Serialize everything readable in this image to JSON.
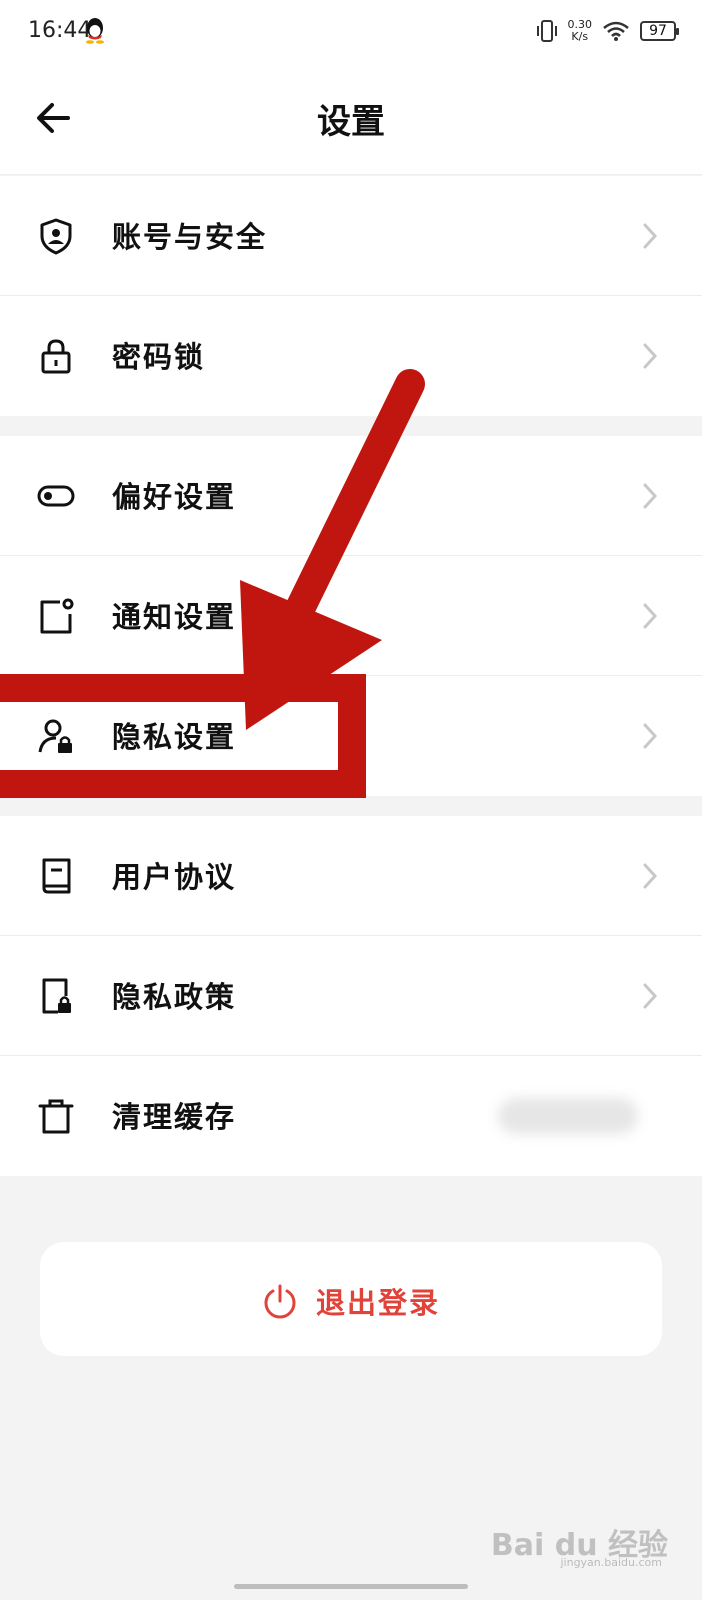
{
  "status_bar": {
    "time": "16:44",
    "net_speed_value": "0.30",
    "net_speed_unit": "K/s",
    "battery": "97"
  },
  "header": {
    "title": "设置"
  },
  "groups": [
    {
      "items": [
        {
          "label": "账号与安全",
          "icon": "shield-user-icon"
        },
        {
          "label": "密码锁",
          "icon": "lock-icon"
        }
      ]
    },
    {
      "items": [
        {
          "label": "偏好设置",
          "icon": "toggle-icon"
        },
        {
          "label": "通知设置",
          "icon": "notification-icon"
        },
        {
          "label": "隐私设置",
          "icon": "user-lock-icon"
        }
      ]
    },
    {
      "items": [
        {
          "label": "用户协议",
          "icon": "book-icon"
        },
        {
          "label": "隐私政策",
          "icon": "document-lock-icon"
        },
        {
          "label": "清理缓存",
          "icon": "trash-icon"
        }
      ]
    }
  ],
  "logout": {
    "label": "退出登录",
    "color": "#e0433a"
  },
  "annotation": {
    "color": "#c0160f"
  },
  "watermark": {
    "text": "Bai du 经验",
    "subtext": "jingyan.baidu.com"
  }
}
